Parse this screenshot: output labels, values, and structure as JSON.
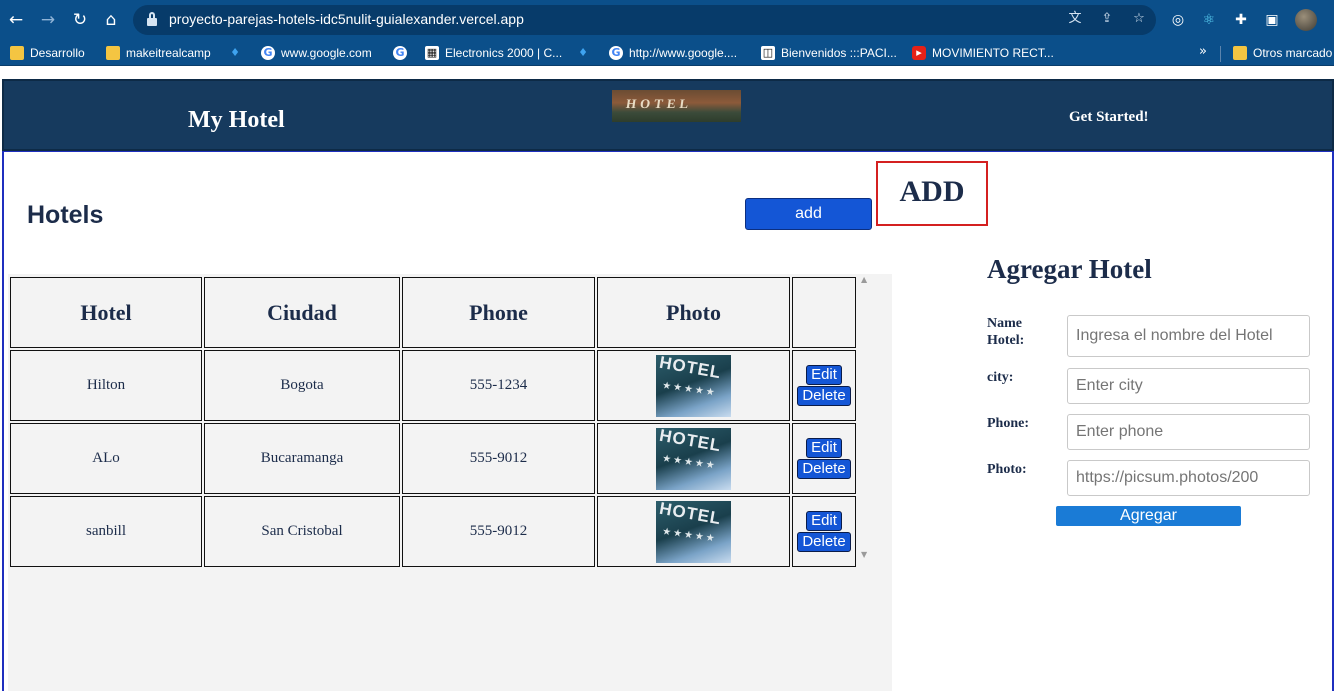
{
  "browser": {
    "url": "proyecto-parejas-hotels-idc5nulit-guialexander.vercel.app",
    "bookmarks": [
      {
        "label": "Desarrollo",
        "icon": "folder-icon"
      },
      {
        "label": "makeitrealcamp",
        "icon": "folder-icon"
      },
      {
        "label": "",
        "icon": "twitter-icon"
      },
      {
        "label": "www.google.com",
        "icon": "google-icon"
      },
      {
        "label": "",
        "icon": "google-icon"
      },
      {
        "label": "Electronics 2000 | C...",
        "icon": "site-icon"
      },
      {
        "label": "",
        "icon": "twitter-icon"
      },
      {
        "label": "http://www.google....",
        "icon": "google-icon"
      },
      {
        "label": "Bienvenidos :::PACI...",
        "icon": "site-icon"
      },
      {
        "label": "MOVIMIENTO RECT...",
        "icon": "youtube-icon"
      },
      {
        "label": "Otros marcado",
        "icon": "folder-icon"
      }
    ]
  },
  "header": {
    "brand": "My Hotel",
    "logo_text": "HOTEL",
    "get_started": "Get Started!"
  },
  "main": {
    "title": "Hotels",
    "add_button": "add",
    "add_box_label": "ADD",
    "table": {
      "columns": [
        "Hotel",
        "Ciudad",
        "Phone",
        "Photo",
        ""
      ],
      "rows": [
        {
          "hotel": "Hilton",
          "ciudad": "Bogota",
          "phone": "555-1234",
          "photo_text": "HOTEL",
          "edit": "Edit",
          "delete": "Delete"
        },
        {
          "hotel": "ALo",
          "ciudad": "Bucaramanga",
          "phone": "555-9012",
          "photo_text": "HOTEL",
          "edit": "Edit",
          "delete": "Delete"
        },
        {
          "hotel": "sanbill",
          "ciudad": "San Cristobal",
          "phone": "555-9012",
          "photo_text": "HOTEL",
          "edit": "Edit",
          "delete": "Delete"
        }
      ]
    }
  },
  "form": {
    "title": "Agregar Hotel",
    "name_label_line1": "Name",
    "name_label_line2": "Hotel:",
    "name_placeholder": "Ingresa el nombre del Hotel",
    "city_label": "city:",
    "city_placeholder": "Enter city",
    "phone_label": "Phone:",
    "phone_placeholder": "Enter phone",
    "photo_label": "Photo:",
    "photo_placeholder": "https://picsum.photos/200",
    "submit": "Agregar"
  }
}
